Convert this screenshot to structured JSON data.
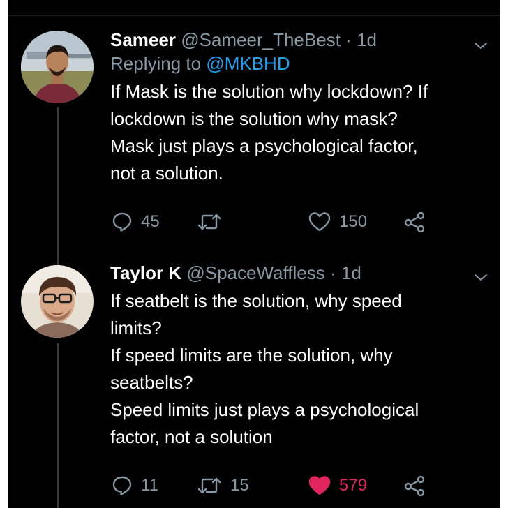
{
  "tweets": [
    {
      "name": "Sameer",
      "handle": "@Sameer_TheBest",
      "separator": "·",
      "time": "1d",
      "replying_prefix": "Replying to ",
      "replying_to": "@MKBHD",
      "text": "If Mask is the solution why lockdown? If\nlockdown is the solution why mask?\nMask just plays a psychological factor,\nnot a solution.",
      "replies": "45",
      "retweets": "",
      "likes": "150",
      "liked": false,
      "avatar_icon": "avatar-photo-man-outdoors"
    },
    {
      "name": "Taylor K",
      "handle": "@SpaceWaffless",
      "separator": "·",
      "time": "1d",
      "text": "If seatbelt is the solution, why speed\nlimits?\nIf speed limits are the solution, why\nseatbelts?\nSpeed limits just plays a psychological\nfactor, not a solution",
      "replies": "11",
      "retweets": "15",
      "likes": "579",
      "liked": true,
      "avatar_icon": "avatar-photo-man-glasses"
    }
  ],
  "colors": {
    "background": "#000000",
    "secondary_text": "#8899a6",
    "link": "#1da1f2",
    "liked_heart": "#e0245e"
  },
  "icons": [
    "reply-icon",
    "retweet-icon",
    "like-icon",
    "share-icon",
    "chevron-down-icon"
  ]
}
